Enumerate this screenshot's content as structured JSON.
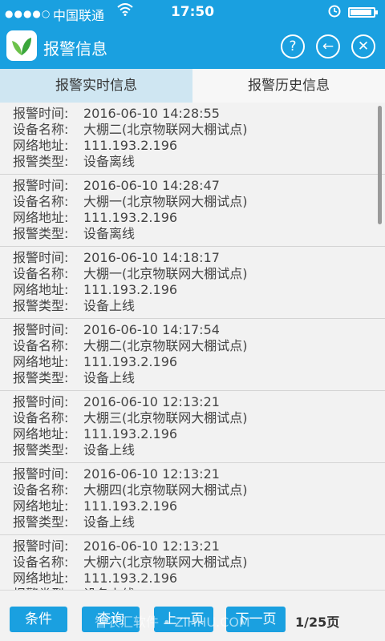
{
  "status_bar": {
    "signal": "●●●●○",
    "carrier": "中国联通",
    "time": "17:50"
  },
  "header": {
    "title": "报警信息",
    "help_glyph": "?",
    "back_glyph": "←",
    "close_glyph": "✕"
  },
  "tabs": [
    {
      "label": "报警实时信息",
      "active": true
    },
    {
      "label": "报警历史信息",
      "active": false
    }
  ],
  "labels": {
    "alarm_time": "报警时间:",
    "device_name": "设备名称:",
    "network_address": "网络地址:",
    "alarm_type": "报警类型:"
  },
  "records": [
    {
      "time": "2016-06-10 14:28:55",
      "device": "大棚二(北京物联网大棚试点)",
      "address": "111.193.2.196",
      "type": "设备离线"
    },
    {
      "time": "2016-06-10 14:28:47",
      "device": "大棚一(北京物联网大棚试点)",
      "address": "111.193.2.196",
      "type": "设备离线"
    },
    {
      "time": "2016-06-10 14:18:17",
      "device": "大棚一(北京物联网大棚试点)",
      "address": "111.193.2.196",
      "type": "设备上线"
    },
    {
      "time": "2016-06-10 14:17:54",
      "device": "大棚二(北京物联网大棚试点)",
      "address": "111.193.2.196",
      "type": "设备上线"
    },
    {
      "time": "2016-06-10 12:13:21",
      "device": "大棚三(北京物联网大棚试点)",
      "address": "111.193.2.196",
      "type": "设备上线"
    },
    {
      "time": "2016-06-10 12:13:21",
      "device": "大棚四(北京物联网大棚试点)",
      "address": "111.193.2.196",
      "type": "设备上线"
    },
    {
      "time": "2016-06-10 12:13:21",
      "device": "大棚六(北京物联网大棚试点)",
      "address": "111.193.2.196",
      "type": "设备上线"
    }
  ],
  "footer": {
    "condition_label": "条件",
    "query_label": "查询",
    "prev_label": "上一页",
    "next_label": "下一页",
    "page_info": "1/25页",
    "watermark": "智农汇软件 • ZIHHU.COM"
  },
  "colors": {
    "accent": "#1aa0e0",
    "active_tab": "#cfe6f2"
  },
  "icons": [
    "wifi-icon",
    "alarm-clock-icon",
    "battery-icon",
    "leaf-logo-icon",
    "help-icon",
    "back-arrow-icon",
    "close-icon"
  ]
}
